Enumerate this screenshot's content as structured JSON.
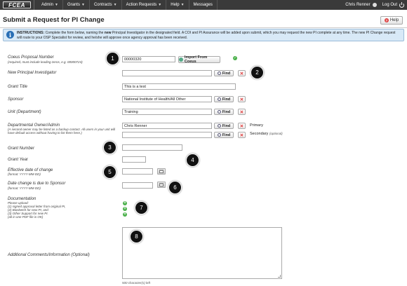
{
  "nav": {
    "logo": "FCEA",
    "items": [
      {
        "label": "Admin",
        "has_menu": true
      },
      {
        "label": "Grants",
        "has_menu": true
      },
      {
        "label": "Contracts",
        "has_menu": true
      },
      {
        "label": "Action Requests",
        "has_menu": true
      },
      {
        "label": "Help",
        "has_menu": true
      },
      {
        "label": "Messages",
        "has_menu": false
      }
    ],
    "user_name": "Chris Renner",
    "logout_label": "Log Out"
  },
  "page": {
    "title": "Submit a Request for PI Change",
    "help_label": "Help"
  },
  "instructions": {
    "heading": "INSTRUCTIONS:",
    "text_before_bold": "Complete the form below, naming the ",
    "bold_word": "new",
    "text_after_bold": " Principal Investigator in the designated field. A COI and PI Assurance will be added upon submit, which you may request the new PI complete at any time. The new PI Change request will route to your OSP Specialist for review, and he/she will approve once agency approval has been received."
  },
  "form": {
    "proposal_number": {
      "label": "Coeus Proposal Number",
      "hint": "(required, must include leading zeros, e.g. 00000724)",
      "value": "00000320",
      "import_label": "Import From Coeus"
    },
    "new_pi": {
      "label": "New Principal Investigator",
      "value": "",
      "find_label": "Find"
    },
    "grant_title": {
      "label": "Grant Title",
      "value": "This is a test"
    },
    "sponsor": {
      "label": "Sponsor",
      "value": "National Institute of Health/All Other",
      "find_label": "Find"
    },
    "unit": {
      "label": "Unit (Department)",
      "value": "Training",
      "find_label": "Find"
    },
    "owner_admin": {
      "label": "Departmental Owner/Admin",
      "hint": "(A second owner may be listed as a backup contact. All users in your unit will have default access without having to list them here.)",
      "primary_value": "Chris Renner",
      "secondary_value": "",
      "find_label": "Find",
      "primary_label": "Primary",
      "secondary_label": "Secondary",
      "secondary_note": "(optional)"
    },
    "grant_number": {
      "label": "Grant Number",
      "value": ""
    },
    "grant_year": {
      "label": "Grant Year",
      "value": ""
    },
    "effective_date": {
      "label": "Effective date of change",
      "hint": "(format: YYYY-MM-DD)",
      "value": ""
    },
    "due_date": {
      "label": "Date change is due to Sponsor",
      "hint": "(format: YYYY-MM-DD)",
      "value": ""
    },
    "documentation": {
      "label": "Documentation",
      "hint_title": "Please upload:",
      "hints": [
        "(1) signed approval letter from original PI,",
        "(2) Biosketch for new PI, and",
        "(3) Other Support for new PI.",
        "(all in one PDF file is OK)"
      ]
    },
    "comments": {
      "label": "Additional Comments/Information (Optional)",
      "value": "",
      "chars_left": "500 character(s) left"
    }
  },
  "callouts": [
    "1",
    "2",
    "3",
    "4",
    "5",
    "6",
    "7",
    "8"
  ]
}
